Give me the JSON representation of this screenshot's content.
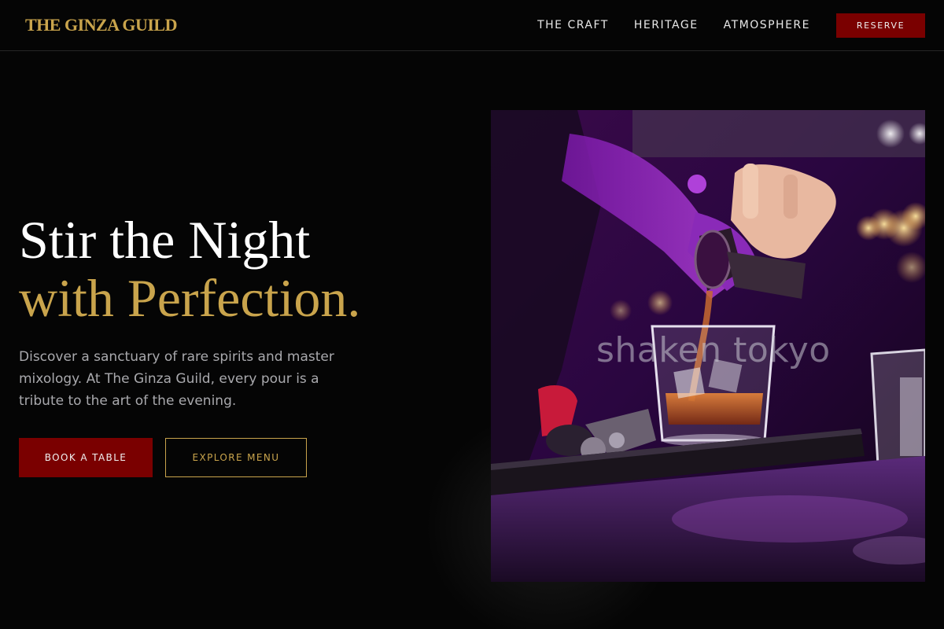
{
  "header": {
    "logo": "THE GINZA GUILD",
    "nav": [
      {
        "label": "THE CRAFT"
      },
      {
        "label": "HERITAGE"
      },
      {
        "label": "ATMOSPHERE"
      }
    ],
    "reserve_label": "RESERVE"
  },
  "hero": {
    "title_line1": "Stir the Night",
    "title_line2": "with Perfection.",
    "description": "Discover a sanctuary of rare spirits and master mixology. At The Ginza Guild, every pour is a tribute to the art of the evening.",
    "primary_button": "BOOK A TABLE",
    "secondary_button": "EXPLORE MENU",
    "image": {
      "subject": "bartender pouring from a jigger into a cocktail glass under purple light",
      "watermark": "shaken tokyo"
    }
  },
  "colors": {
    "background": "#050505",
    "gold_accent": "#c9a44c",
    "crimson": "#7a0000",
    "text_muted": "#a9a9ad"
  }
}
